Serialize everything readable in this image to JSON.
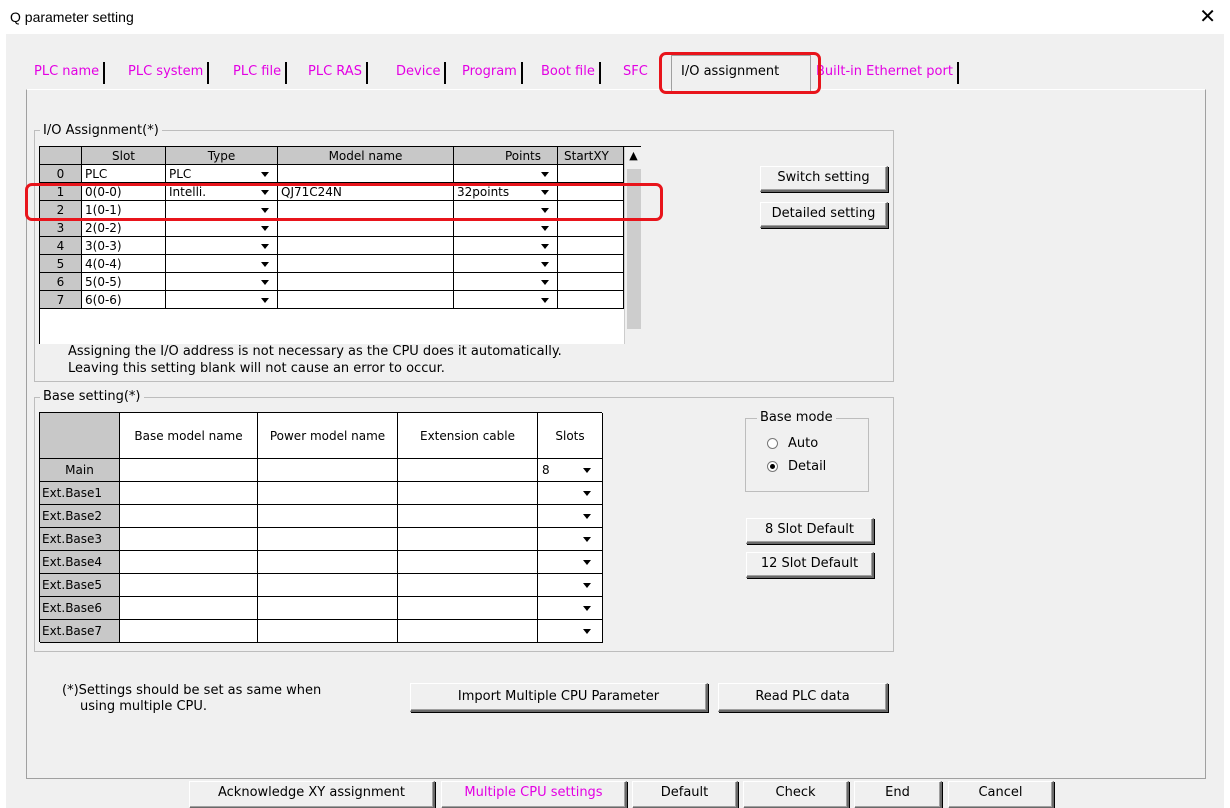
{
  "window": {
    "title": "Q parameter setting",
    "close": "✕"
  },
  "tabs": [
    {
      "label": "PLC name"
    },
    {
      "label": "PLC system"
    },
    {
      "label": "PLC file"
    },
    {
      "label": "PLC RAS"
    },
    {
      "label": "Device"
    },
    {
      "label": "Program"
    },
    {
      "label": "Boot file"
    },
    {
      "label": "SFC"
    },
    {
      "label": "I/O assignment"
    },
    {
      "label": "Built-in Ethernet port"
    }
  ],
  "io": {
    "group_label": "I/O Assignment(*)",
    "headers": {
      "slot": "Slot",
      "type": "Type",
      "model": "Model name",
      "points": "Points",
      "startxy": "StartXY"
    },
    "rows": [
      {
        "num": "0",
        "slot": "PLC",
        "type": "PLC",
        "model": "",
        "points": "",
        "startxy": ""
      },
      {
        "num": "1",
        "slot": "0(0-0)",
        "type": "Intelli.",
        "model": "QJ71C24N",
        "points": "32points",
        "startxy": ""
      },
      {
        "num": "2",
        "slot": "1(0-1)",
        "type": "",
        "model": "",
        "points": "",
        "startxy": ""
      },
      {
        "num": "3",
        "slot": "2(0-2)",
        "type": "",
        "model": "",
        "points": "",
        "startxy": ""
      },
      {
        "num": "4",
        "slot": "3(0-3)",
        "type": "",
        "model": "",
        "points": "",
        "startxy": ""
      },
      {
        "num": "5",
        "slot": "4(0-4)",
        "type": "",
        "model": "",
        "points": "",
        "startxy": ""
      },
      {
        "num": "6",
        "slot": "5(0-5)",
        "type": "",
        "model": "",
        "points": "",
        "startxy": ""
      },
      {
        "num": "7",
        "slot": "6(0-6)",
        "type": "",
        "model": "",
        "points": "",
        "startxy": ""
      }
    ],
    "switch_setting": "Switch setting",
    "detailed_setting": "Detailed setting",
    "note_line1": "Assigning the I/O address is not necessary as the CPU does it automatically.",
    "note_line2": "Leaving this setting blank will not cause an error to occur."
  },
  "base": {
    "group_label": "Base setting(*)",
    "headers": {
      "base_model": "Base model name",
      "power_model": "Power model name",
      "ext_cable": "Extension cable",
      "slots": "Slots"
    },
    "rows": [
      {
        "name": "Main",
        "slots": "8"
      },
      {
        "name": "Ext.Base1",
        "slots": ""
      },
      {
        "name": "Ext.Base2",
        "slots": ""
      },
      {
        "name": "Ext.Base3",
        "slots": ""
      },
      {
        "name": "Ext.Base4",
        "slots": ""
      },
      {
        "name": "Ext.Base5",
        "slots": ""
      },
      {
        "name": "Ext.Base6",
        "slots": ""
      },
      {
        "name": "Ext.Base7",
        "slots": ""
      }
    ],
    "mode_label": "Base mode",
    "mode_auto": "Auto",
    "mode_detail": "Detail",
    "selected_mode": "Detail",
    "slot8_default": "8 Slot Default",
    "slot12_default": "12 Slot Default"
  },
  "footer": {
    "note_line1": "(*)Settings should be set as same when",
    "note_line2": "using multiple CPU.",
    "import_button": "Import Multiple CPU Parameter",
    "read_button": "Read PLC data"
  },
  "bottom_buttons": {
    "ack": "Acknowledge XY assignment",
    "multi_cpu": "Multiple CPU settings",
    "default": "Default",
    "check": "Check",
    "end": "End",
    "cancel": "Cancel"
  },
  "highlight_color": "#e8141b",
  "tab_link_color": "#e300e3"
}
